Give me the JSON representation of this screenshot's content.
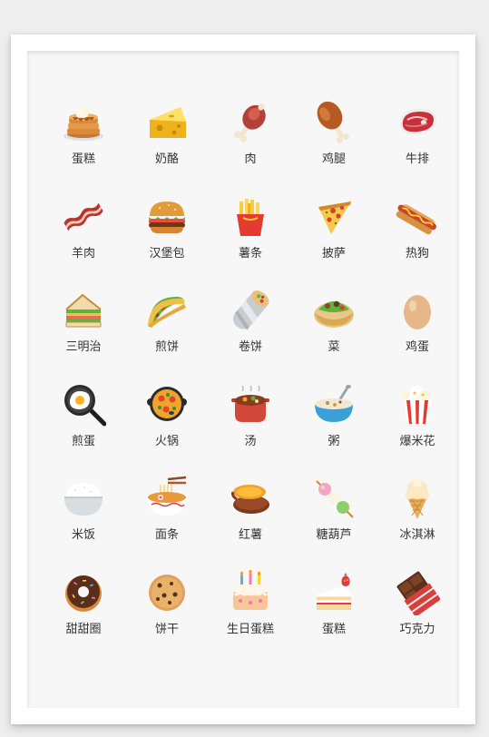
{
  "items": [
    {
      "label": "蛋糕",
      "icon": "pancake-stack-icon"
    },
    {
      "label": "奶酪",
      "icon": "cheese-icon"
    },
    {
      "label": "肉",
      "icon": "meat-on-bone-icon"
    },
    {
      "label": "鸡腿",
      "icon": "drumstick-icon"
    },
    {
      "label": "牛排",
      "icon": "steak-icon"
    },
    {
      "label": "羊肉",
      "icon": "bacon-icon"
    },
    {
      "label": "汉堡包",
      "icon": "hamburger-icon"
    },
    {
      "label": "薯条",
      "icon": "french-fries-icon"
    },
    {
      "label": "披萨",
      "icon": "pizza-slice-icon"
    },
    {
      "label": "热狗",
      "icon": "hot-dog-icon"
    },
    {
      "label": "三明治",
      "icon": "sandwich-icon"
    },
    {
      "label": "煎饼",
      "icon": "taco-icon"
    },
    {
      "label": "卷饼",
      "icon": "burrito-icon"
    },
    {
      "label": "菜",
      "icon": "stuffed-flatbread-icon"
    },
    {
      "label": "鸡蛋",
      "icon": "egg-icon"
    },
    {
      "label": "煎蛋",
      "icon": "frying-pan-egg-icon"
    },
    {
      "label": "火锅",
      "icon": "paella-pan-icon"
    },
    {
      "label": "汤",
      "icon": "stew-pot-icon"
    },
    {
      "label": "粥",
      "icon": "bowl-with-spoon-icon"
    },
    {
      "label": "爆米花",
      "icon": "popcorn-icon"
    },
    {
      "label": "米饭",
      "icon": "rice-bowl-icon"
    },
    {
      "label": "面条",
      "icon": "noodle-bowl-icon"
    },
    {
      "label": "红薯",
      "icon": "roasted-sweet-potato-icon"
    },
    {
      "label": "糖葫芦",
      "icon": "dango-icon"
    },
    {
      "label": "冰淇淋",
      "icon": "ice-cream-cone-icon"
    },
    {
      "label": "甜甜圈",
      "icon": "doughnut-icon"
    },
    {
      "label": "饼干",
      "icon": "cookie-icon"
    },
    {
      "label": "生日蛋糕",
      "icon": "birthday-cake-icon"
    },
    {
      "label": "蛋糕",
      "icon": "shortcake-icon"
    },
    {
      "label": "巧克力",
      "icon": "chocolate-bar-icon"
    }
  ]
}
